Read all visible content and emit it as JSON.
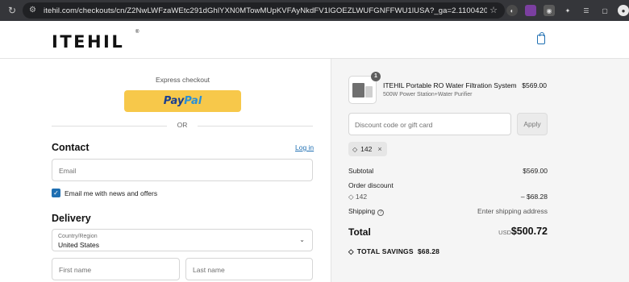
{
  "browser": {
    "url": "itehil.com/checkouts/cn/Z2NwLWFzaWEtc291dGhlYXN0MTowMUpKVFAyNkdFV1lGOEZLWUFGNFFWU1lUSA?_ga=2.110042048.477077112.173820...",
    "ext_colors": [
      "#4a4a4a",
      "#7b3fa0",
      "#5a5a5a",
      "#5a5a5a",
      "#5a5a5a",
      "#5a5a5a",
      "#5a5a5a"
    ]
  },
  "header": {
    "logo": "ITEHIL",
    "logo_mark": "®",
    "cart_icon": "shopping-bag-icon",
    "accent_color": "#1f6fb2"
  },
  "checkout": {
    "express_label": "Express checkout",
    "paypal_part1": "Pay",
    "paypal_part2": "Pal",
    "or_label": "OR",
    "contact": {
      "heading": "Contact",
      "login_label": "Log in",
      "email_placeholder": "Email",
      "newsletter_label": "Email me with news and offers",
      "newsletter_checked": true
    },
    "delivery": {
      "heading": "Delivery",
      "country_label": "Country/Region",
      "country_value": "United States",
      "first_name_placeholder": "First name",
      "last_name_placeholder": "Last name"
    }
  },
  "summary": {
    "item": {
      "quantity": "1",
      "name": "ITEHIL Portable RO Water Filtration System",
      "variant": "500W Power Station+Water Purifier",
      "price": "$569.00"
    },
    "discount_placeholder": "Discount code or gift card",
    "apply_label": "Apply",
    "applied_code": "142",
    "subtotal_label": "Subtotal",
    "subtotal_value": "$569.00",
    "order_discount_label": "Order discount",
    "discount_code": "142",
    "discount_value": "– $68.28",
    "shipping_label": "Shipping",
    "shipping_value": "Enter shipping address",
    "total_label": "Total",
    "total_currency": "USD",
    "total_value": "$500.72",
    "savings_label": "TOTAL SAVINGS",
    "savings_value": "$68.28"
  }
}
